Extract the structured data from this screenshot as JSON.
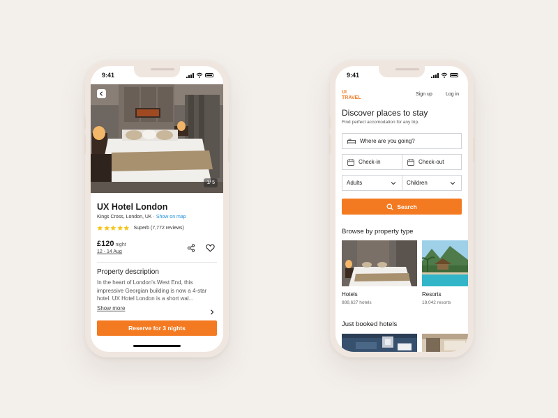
{
  "status": {
    "time": "9:41"
  },
  "detail": {
    "image_counter": "1/ 5",
    "title": "UX Hotel London",
    "location": "Kings Cross, London, UK",
    "location_sep": " · ",
    "map_link": "Show on map",
    "rating_stars": 5,
    "rating_text": "Superb (7,772 reviews)",
    "price": "£120",
    "price_unit": "night",
    "dates": "12 - 14 Aug",
    "description_title": "Property description",
    "description": "In the heart of London's West End, this impressive Georgian building is now a 4-star hotel. UX Hotel London is a short wal...",
    "show_more": "Show more",
    "reserve_label": "Reserve for 3 nights"
  },
  "search": {
    "logo_line1": "UI",
    "logo_line2": "TRAVEL",
    "signup": "Sign up",
    "login": "Log in",
    "title": "Discover places to stay",
    "subtitle": "Find perfect accomodation for any trip.",
    "destination_placeholder": "Where are you going?",
    "checkin": "Check-in",
    "checkout": "Check-out",
    "adults": "Adults",
    "children": "Children",
    "search_label": "Search",
    "browse_title": "Browse by property type",
    "property_types": [
      {
        "name": "Hotels",
        "count": "888,627 hotels"
      },
      {
        "name": "Resorts",
        "count": "18,042 resorts"
      }
    ],
    "booked_title": "Just booked hotels"
  },
  "colors": {
    "accent": "#f47a21",
    "link": "#1f8fd6",
    "star": "#f5c518"
  },
  "icons": [
    "back-chevron-icon",
    "share-icon",
    "heart-icon",
    "chevron-right-icon",
    "bed-icon",
    "calendar-icon",
    "chevron-down-icon",
    "search-icon",
    "signal-icon",
    "wifi-icon",
    "battery-icon",
    "star-icon"
  ]
}
